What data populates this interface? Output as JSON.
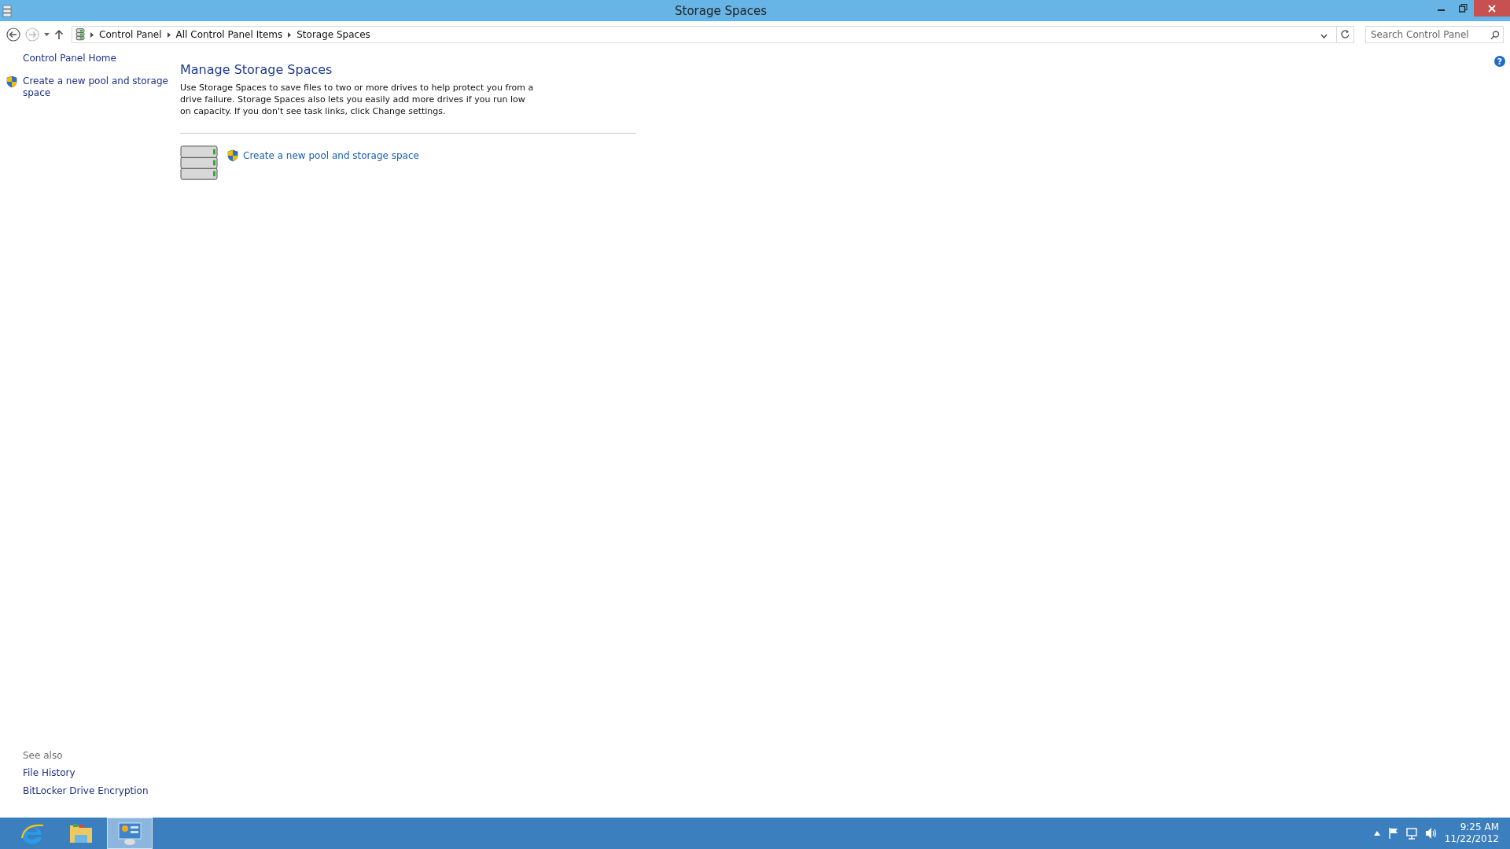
{
  "window": {
    "title": "Storage Spaces"
  },
  "navigation": {
    "back_disabled": false,
    "forward_disabled": true
  },
  "address_bar": {
    "breadcrumbs": [
      "Control Panel",
      "All Control Panel Items",
      "Storage Spaces"
    ]
  },
  "search": {
    "placeholder": "Search Control Panel"
  },
  "help": {
    "glyph": "?"
  },
  "sidebar": {
    "links": [
      {
        "label": "Control Panel Home",
        "kind": "plain"
      },
      {
        "label": "Create a new pool and storage space",
        "kind": "shield"
      }
    ],
    "see_also": {
      "heading": "See also",
      "links": [
        "File History",
        "BitLocker Drive Encryption"
      ]
    }
  },
  "main": {
    "heading": "Manage Storage Spaces",
    "description": "Use Storage Spaces to save files to two or more drives to help protect you from a drive failure. Storage Spaces also lets you easily add more drives if you run low on capacity. If you don't see task links, click Change settings.",
    "tasks": [
      {
        "label": "Create a new pool and storage space"
      }
    ]
  },
  "taskbar": {
    "apps": [
      {
        "kind": "browser",
        "selected": false
      },
      {
        "kind": "folder",
        "selected": false
      },
      {
        "kind": "control-panel",
        "selected": true
      }
    ],
    "clock": {
      "time": "9:25 AM",
      "date": "11/22/2012"
    }
  }
}
